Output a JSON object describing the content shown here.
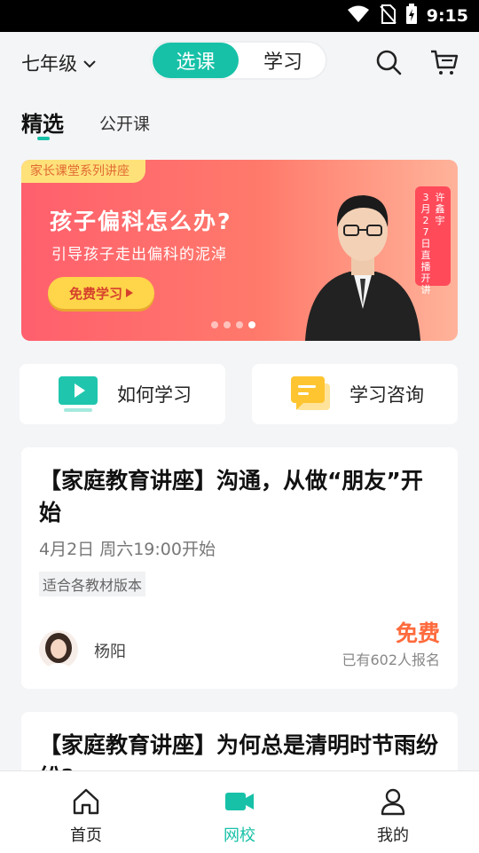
{
  "status_bar": {
    "time": "9:15",
    "icons": [
      "wifi-icon",
      "no-sim-icon",
      "battery-charging-icon"
    ]
  },
  "header": {
    "grade": "七年级",
    "segment": {
      "active": "选课",
      "inactive": "学习"
    },
    "icons": [
      "search-icon",
      "cart-icon"
    ],
    "accent_color": "#17c1a7"
  },
  "tabs": {
    "selected": "精选",
    "other": "公开课"
  },
  "banner": {
    "badge": "家长课堂系列讲座",
    "title": "孩子偏科怎么办?",
    "subtitle": "引导孩子走出偏科的泥淖",
    "cta": "免费学习",
    "vertical_text": [
      "许鑫宇",
      "3月27日直播开讲"
    ],
    "page_count": 4,
    "active_page": 4
  },
  "quick_actions": [
    {
      "label": "如何学习",
      "icon": "video-play-icon"
    },
    {
      "label": "学习咨询",
      "icon": "chat-bubble-icon"
    }
  ],
  "courses": [
    {
      "title": "【家庭教育讲座】沟通，从做“朋友”开始",
      "time": "4月2日 周六19:00开始",
      "tag": "适合各教材版本",
      "teacher": "杨阳",
      "price": "免费",
      "enrolled": "已有602人报名"
    },
    {
      "title": "【家庭教育讲座】为何总是清明时节雨纷纷?",
      "time": "",
      "tag": "",
      "teacher": "",
      "price": "",
      "enrolled": ""
    }
  ],
  "bottom_nav": [
    {
      "label": "首页",
      "icon": "home-icon"
    },
    {
      "label": "网校",
      "icon": "video-camera-icon",
      "active": true
    },
    {
      "label": "我的",
      "icon": "user-icon"
    }
  ]
}
